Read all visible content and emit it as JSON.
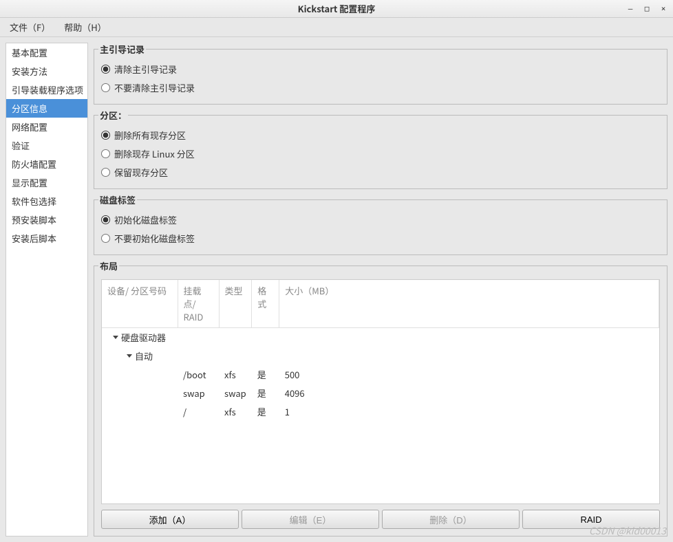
{
  "window": {
    "title": "Kickstart 配置程序"
  },
  "menubar": {
    "file": "文件（F）",
    "help": "帮助（H）"
  },
  "sidebar": {
    "items": [
      {
        "label": "基本配置",
        "selected": false
      },
      {
        "label": "安装方法",
        "selected": false
      },
      {
        "label": "引导装载程序选项",
        "selected": false
      },
      {
        "label": "分区信息",
        "selected": true
      },
      {
        "label": "网络配置",
        "selected": false
      },
      {
        "label": "验证",
        "selected": false
      },
      {
        "label": "防火墙配置",
        "selected": false
      },
      {
        "label": "显示配置",
        "selected": false
      },
      {
        "label": "软件包选择",
        "selected": false
      },
      {
        "label": "预安装脚本",
        "selected": false
      },
      {
        "label": "安装后脚本",
        "selected": false
      }
    ]
  },
  "mbr": {
    "legend": "主引导记录",
    "clear": "清除主引导记录",
    "noclear": "不要清除主引导记录",
    "selected": "clear"
  },
  "partitions": {
    "legend": "分区：",
    "remove_all": "删除所有现存分区",
    "remove_linux": "删除现存 Linux 分区",
    "preserve": "保留现存分区",
    "selected": "remove_all"
  },
  "disklabel": {
    "legend": "磁盘标签",
    "init": "初始化磁盘标签",
    "noinit": "不要初始化磁盘标签",
    "selected": "init"
  },
  "layout": {
    "legend": "布局",
    "columns": {
      "device": "设备/\n分区号码",
      "mount": "挂载点/\nRAID",
      "type": "类型",
      "format": "格式",
      "size": "大小（MB）"
    },
    "tree": {
      "root": "硬盘驱动器",
      "child": "自动"
    },
    "rows": [
      {
        "device": "",
        "mount": "/boot",
        "type": "xfs",
        "format": "是",
        "size": "500"
      },
      {
        "device": "",
        "mount": "swap",
        "type": "swap",
        "format": "是",
        "size": "4096"
      },
      {
        "device": "",
        "mount": "/",
        "type": "xfs",
        "format": "是",
        "size": "1"
      }
    ]
  },
  "buttons": {
    "add": "添加（A）",
    "edit": "编辑（E）",
    "delete": "删除（D）",
    "raid": "RAID"
  },
  "watermark": "CSDN @kid00013"
}
